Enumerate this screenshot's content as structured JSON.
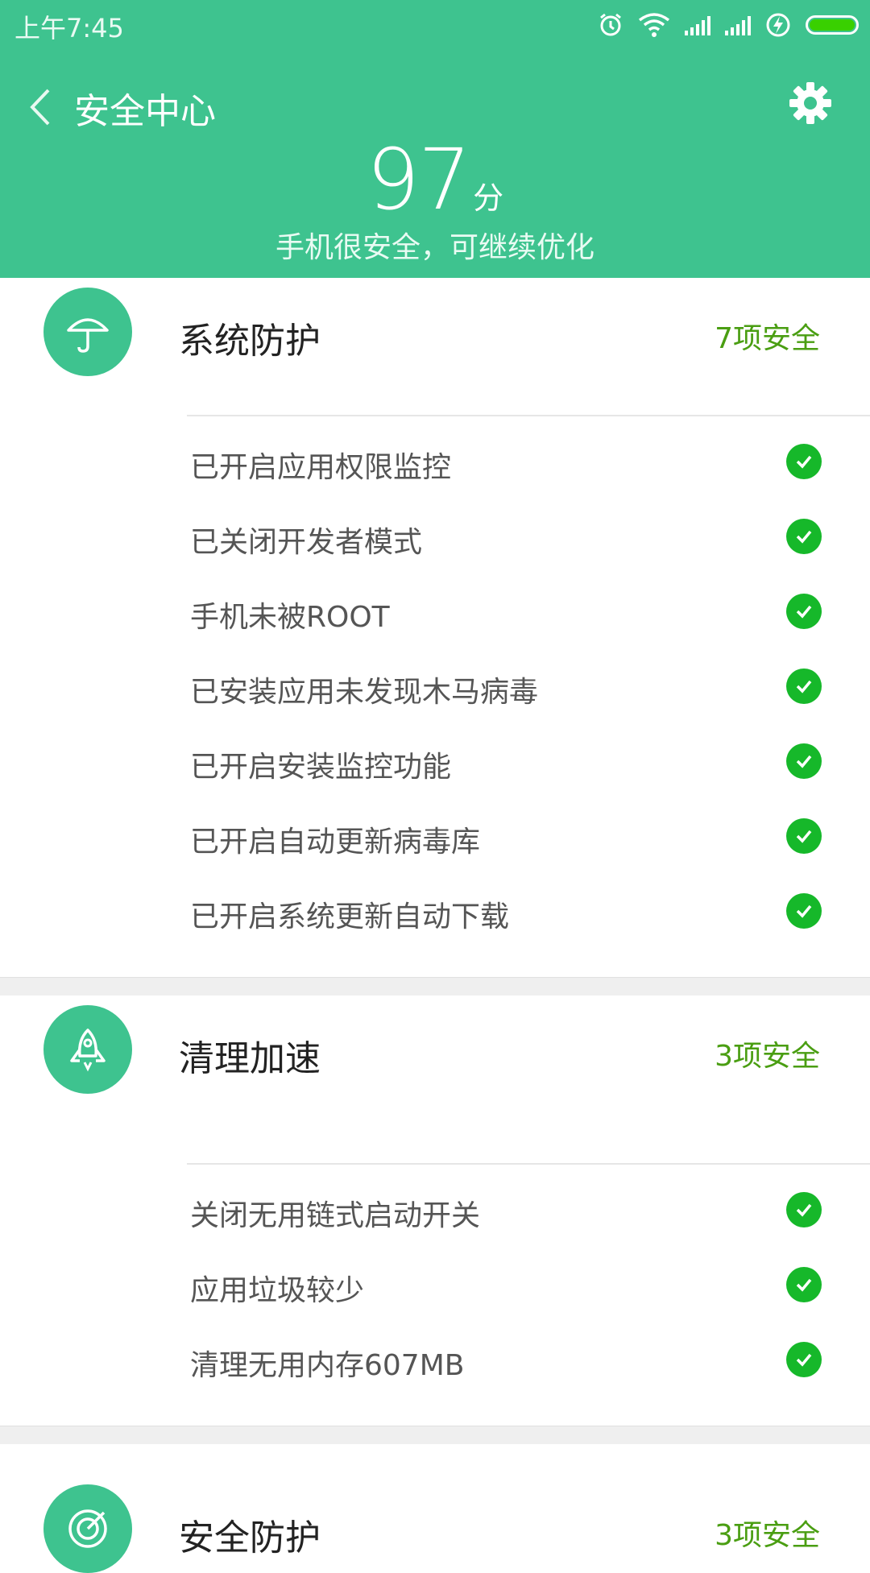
{
  "status_bar": {
    "time": "上午7:45",
    "icons": [
      "alarm-icon",
      "wifi-icon",
      "signal-icon",
      "signal-icon",
      "charging-icon",
      "battery-icon"
    ]
  },
  "header": {
    "title": "安全中心",
    "score": "97",
    "score_unit": "分",
    "subtitle": "手机很安全，可继续优化",
    "background": "#3ec38f"
  },
  "sections": [
    {
      "title": "系统防护",
      "status": "7项安全",
      "icon": "umbrella-icon",
      "items": [
        "已开启应用权限监控",
        "已关闭开发者模式",
        "手机未被ROOT",
        "已安装应用未发现木马病毒",
        "已开启安装监控功能",
        "已开启自动更新病毒库",
        "已开启系统更新自动下载"
      ]
    },
    {
      "title": "清理加速",
      "status": "3项安全",
      "icon": "rocket-icon",
      "items": [
        "关闭无用链式启动开关",
        "应用垃圾较少",
        "清理无用内存607MB"
      ]
    },
    {
      "title": "安全防护",
      "status": "3项安全",
      "icon": "shield-target-icon",
      "items": []
    }
  ],
  "colors": {
    "accent": "#3ec38f",
    "check": "#16b82a",
    "status_text": "#4a9e12"
  }
}
